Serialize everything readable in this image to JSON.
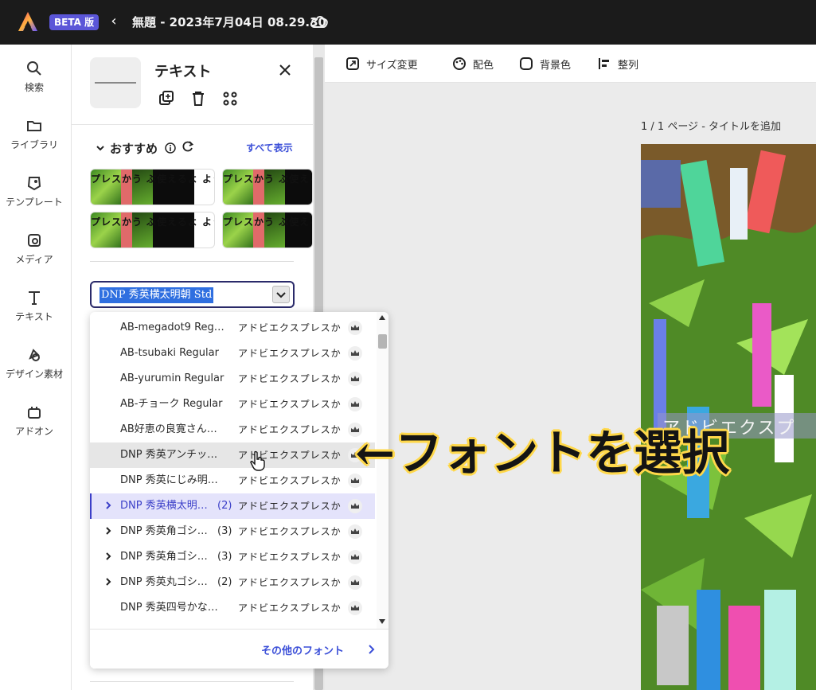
{
  "app": {
    "beta_badge": "BETA 版",
    "doc_title": "無題 - 2023年7月04日 08.29.30"
  },
  "rail": {
    "items": [
      {
        "label": "検索",
        "icon": "search-icon"
      },
      {
        "label": "ライブラリ",
        "icon": "folder-icon"
      },
      {
        "label": "テンプレート",
        "icon": "template-icon"
      },
      {
        "label": "メディア",
        "icon": "media-icon"
      },
      {
        "label": "テキスト",
        "icon": "text-icon"
      },
      {
        "label": "デザイン素材",
        "icon": "design-elements-icon"
      },
      {
        "label": "アドオン",
        "icon": "addon-icon"
      }
    ]
  },
  "panel": {
    "title": "テキスト",
    "recommended": {
      "heading": "おすすめ",
      "see_all": "すべて表示",
      "cards": [
        {
          "text": "プレスかう ぶ使えるよ ように"
        },
        {
          "text": "プレスかう ぶ使えるよ ように"
        },
        {
          "text": "プレスかう ぶ使えるよ ように"
        },
        {
          "text": "プレスかう ぶ使えるよ ように"
        }
      ]
    },
    "font_select_value": "DNP 秀英横太明朝 Std"
  },
  "font_list": {
    "items": [
      {
        "name": "AB-megadot9 Reg…",
        "count": "",
        "preview": "アドビエクスプレスか",
        "has_children": false,
        "state": "normal"
      },
      {
        "name": "AB-tsubaki Regular",
        "count": "",
        "preview": "アドビエクスプレスか",
        "has_children": false,
        "state": "normal"
      },
      {
        "name": "AB-yurumin Regular",
        "count": "",
        "preview": "アドビエクスプレスか",
        "has_children": false,
        "state": "normal"
      },
      {
        "name": "AB-チョーク Regular",
        "count": "",
        "preview": "アドビエクスプレスか",
        "has_children": false,
        "state": "normal"
      },
      {
        "name": "AB好恵の良寛さん…",
        "count": "",
        "preview": "アドビエクスプレスか",
        "has_children": false,
        "state": "normal"
      },
      {
        "name": "DNP 秀英アンチッ…",
        "count": "",
        "preview": "アドビエクスプレスか",
        "has_children": false,
        "state": "hover"
      },
      {
        "name": "DNP 秀英にじみ明…",
        "count": "",
        "preview": "アドビエクスプレスか",
        "has_children": false,
        "state": "normal"
      },
      {
        "name": "DNP 秀英横太明…",
        "count": "(2)",
        "preview": "アドビエクスプレスか",
        "has_children": true,
        "state": "selected"
      },
      {
        "name": "DNP 秀英角ゴシ…",
        "count": "(3)",
        "preview": "アドビエクスプレスか",
        "has_children": true,
        "state": "normal"
      },
      {
        "name": "DNP 秀英角ゴシ…",
        "count": "(3)",
        "preview": "アドビエクスプレスか",
        "has_children": true,
        "state": "normal"
      },
      {
        "name": "DNP 秀英丸ゴシ…",
        "count": "(2)",
        "preview": "アドビエクスプレスか",
        "has_children": true,
        "state": "normal"
      },
      {
        "name": "DNP 秀英四号かな…",
        "count": "",
        "preview": "アドビエクスプレスか",
        "has_children": false,
        "state": "normal"
      }
    ],
    "more_fonts": "その他のフォント"
  },
  "toolbar": {
    "resize": "サイズ変更",
    "color_scheme": "配色",
    "background": "背景色",
    "align": "整列"
  },
  "canvas": {
    "page_label": "1 / 1 ページ - タイトルを追加",
    "photo_text": "アドビエクスプ"
  },
  "annotation": {
    "text": "←フォントを選択"
  },
  "colors": {
    "accent": "#3b4fd8",
    "beta_badge": "#5b56d8",
    "topbar": "#1b1b1b",
    "annotation_outline": "#ffd84a"
  }
}
